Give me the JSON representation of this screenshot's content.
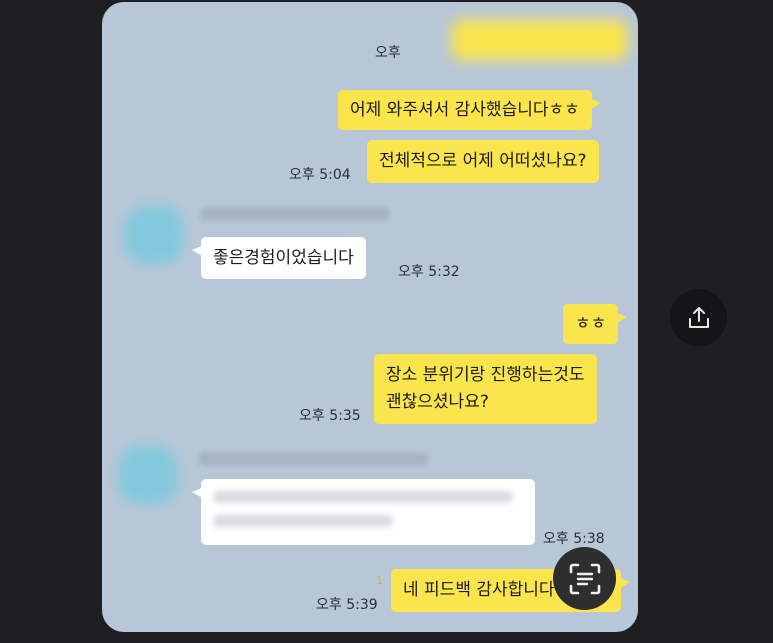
{
  "messages": [
    {
      "side": "me",
      "time": "오후",
      "text": ""
    },
    {
      "side": "me",
      "time": "",
      "text": "어제 와주셔서 감사했습니다ㅎㅎ"
    },
    {
      "side": "me",
      "time": "오후 5:04",
      "text": "전체적으로 어제 어떠셨나요?"
    },
    {
      "side": "other",
      "time": "오후 5:32",
      "text": "좋은경험이었습니다"
    },
    {
      "side": "me",
      "time": "",
      "text": "ㅎㅎ"
    },
    {
      "side": "me",
      "time": "오후 5:35",
      "lines": [
        "장소 분위기랑 진행하는것도",
        "괜찮으셨나요?"
      ]
    },
    {
      "side": "other",
      "time": "오후 5:38",
      "text": ""
    },
    {
      "side": "me",
      "time": "오후 5:39",
      "unread": "1",
      "text": "네 피드백 감사합니다"
    }
  ],
  "icons": {
    "share": "share-icon",
    "scan": "text-scan-icon"
  }
}
